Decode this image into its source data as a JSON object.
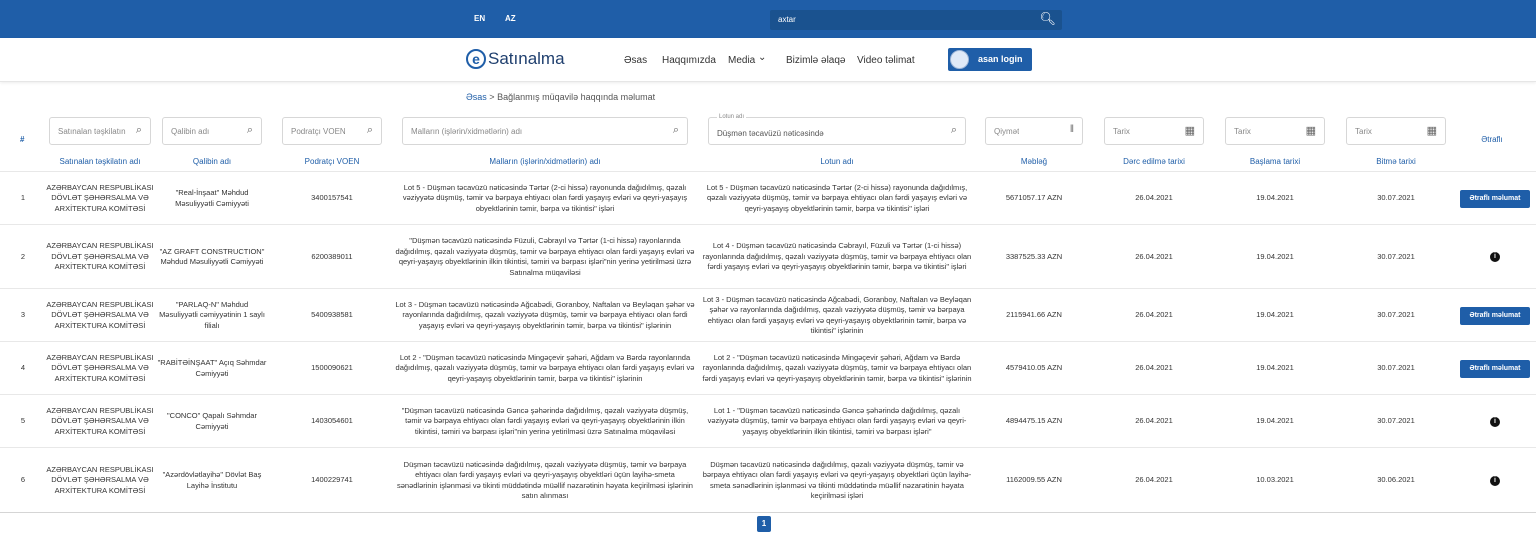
{
  "topbar": {
    "lang_en": "EN",
    "lang_az": "AZ",
    "search_value": "axtar"
  },
  "nav": {
    "logo_e": "e",
    "logo_text": "Satınalma",
    "items": [
      "Əsas",
      "Haqqımızda",
      "Media",
      "Bizimlə əlaqə",
      "Video təlimat"
    ],
    "media_caret": "⌄",
    "login": "asan login"
  },
  "breadcrumb": {
    "home": "Əsas",
    "sep": ">",
    "current": "Bağlanmış müqavilə haqqında məlumat"
  },
  "filters": {
    "org": "Satınalan təşkilatın ...",
    "winner": "Qalibin adı",
    "voen": "Podratçı VOEN",
    "goods": "Malların (işlərin/xidmətlərin) adı",
    "lot_label": "Lotun adı",
    "lot": "Düşmən təcavüzü nəticəsində",
    "price": "Qiymət",
    "date1": "Tarix",
    "date2": "Tarix",
    "date3": "Tarix"
  },
  "headers": {
    "hash": "#",
    "org": "Satınalan təşkilatın adı",
    "winner": "Qalibin adı",
    "voen": "Podratçı VOEN",
    "goods": "Malların (işlərin/xidmətlərin) adı",
    "lot": "Lotun adı",
    "amount": "Məbləğ",
    "pub": "Dərc edilmə tarixi",
    "start": "Başlama tarixi",
    "end": "Bitmə tarixi",
    "more": "Ətraflı"
  },
  "rows": [
    {
      "n": "1",
      "org": "AZƏRBAYCAN RESPUBLİKASI DÖVLƏT ŞƏHƏRSALMA VƏ ARXİTEKTURA KOMİTƏSİ",
      "winner": "\"Real-İnşaat\" Məhdud Məsuliyyətli Cəmiyyəti",
      "voen": "3400157541",
      "goods": "Lot 5 - Düşmən təcavüzü nəticəsində Tərtər (2-ci hissə) rayonunda dağıdılmış, qəzalı vəziyyətə düşmüş, təmir və bərpaya ehtiyacı olan fərdi yaşayış evləri və qeyri-yaşayış obyektlərinin təmir, bərpa və tikintisi\" işləri",
      "lot": "Lot 5 - Düşmən təcavüzü nəticəsində Tərtər (2-ci hissə) rayonunda dağıdılmış, qəzalı vəziyyətə düşmüş, təmir və bərpaya ehtiyacı olan fərdi yaşayış evləri və qeyri-yaşayış obyektlərinin təmir, bərpa və tikintisi\" işləri",
      "amount": "5671057.17 AZN",
      "pub": "26.04.2021",
      "start": "19.04.2021",
      "end": "30.07.2021",
      "action": "button"
    },
    {
      "n": "2",
      "org": "AZƏRBAYCAN RESPUBLİKASI DÖVLƏT ŞƏHƏRSALMA VƏ ARXİTEKTURA KOMİTƏSİ",
      "winner": "\"AZ GRAFT CONSTRUCTION\" Məhdud Məsuliyyətli Cəmiyyəti",
      "voen": "6200389011",
      "goods": "\"Düşmən təcavüzü nəticəsində Füzuli, Cəbrayıl və Tərtər (1-ci hissə) rayonlarında dağıdılmış, qəzalı vəziyyətə düşmüş, təmir və bərpaya ehtiyacı olan fərdi yaşayış evləri və qeyri-yaşayış obyektlərinin ilkin tikintisi, təmiri və bərpası işləri\"nin yerinə yetirilməsi üzrə Satınalma müqaviləsi",
      "lot": "Lot 4 - Düşmən təcavüzü nəticəsində Cəbrayıl, Füzuli və Tərtər (1-ci hissə) rayonlarında dağıdılmış, qəzalı vəziyyətə düşmüş, təmir və bərpaya ehtiyacı olan fərdi yaşayış evləri və qeyri-yaşayış obyektlərinin təmir, bərpa və tikintisi\" işləri",
      "amount": "3387525.33 AZN",
      "pub": "26.04.2021",
      "start": "19.04.2021",
      "end": "30.07.2021",
      "action": "info"
    },
    {
      "n": "3",
      "org": "AZƏRBAYCAN RESPUBLİKASI DÖVLƏT ŞƏHƏRSALMA VƏ ARXİTEKTURA KOMİTƏSİ",
      "winner": "\"PARLAQ-N\" Məhdud Məsuliyyətli cəmiyyətinin 1 saylı filialı",
      "voen": "5400938581",
      "goods": "Lot 3 - Düşmən təcavüzü nəticəsində Ağcabədi, Goranboy, Naftalan və Beyləqan şəhər və rayonlarında dağıdılmış, qəzalı vəziyyətə düşmüş, təmir və bərpaya ehtiyacı olan fərdi yaşayış evləri və qeyri-yaşayış obyektlərinin təmir, bərpa və tikintisi\" işlərinin",
      "lot": "Lot 3 - Düşmən təcavüzü nəticəsində Ağcabədi, Goranboy, Naftalan və Beyləqan şəhər və rayonlarında dağıdılmış, qəzalı vəziyyətə düşmüş, təmir və bərpaya ehtiyacı olan fərdi yaşayış evləri və qeyri-yaşayış obyektlərinin təmir, bərpa və tikintisi\" işlərinin",
      "amount": "2115941.66 AZN",
      "pub": "26.04.2021",
      "start": "19.04.2021",
      "end": "30.07.2021",
      "action": "button"
    },
    {
      "n": "4",
      "org": "AZƏRBAYCAN RESPUBLİKASI DÖVLƏT ŞƏHƏRSALMA VƏ ARXİTEKTURA KOMİTƏSİ",
      "winner": "\"RABİTƏİNŞAAT\" Açıq Səhmdar Cəmiyyəti",
      "voen": "1500090621",
      "goods": "Lot 2 - \"Düşmən təcavüzü nəticəsində Mingəçevir şəhəri, Ağdam və Bərdə rayonlarında dağıdılmış, qəzalı vəziyyətə düşmüş, təmir və bərpaya ehtiyacı olan fərdi yaşayış evləri və qeyri-yaşayış obyektlərinin təmir, bərpa və tikintisi\" işlərinin",
      "lot": "Lot 2 - \"Düşmən təcavüzü nəticəsində Mingəçevir şəhəri, Ağdam və Bərdə rayonlarında dağıdılmış, qəzalı vəziyyətə düşmüş, təmir və bərpaya ehtiyacı olan fərdi yaşayış evləri və qeyri-yaşayış obyektlərinin təmir, bərpa və tikintisi\" işlərinin",
      "amount": "4579410.05 AZN",
      "pub": "26.04.2021",
      "start": "19.04.2021",
      "end": "30.07.2021",
      "action": "button"
    },
    {
      "n": "5",
      "org": "AZƏRBAYCAN RESPUBLİKASI DÖVLƏT ŞƏHƏRSALMA VƏ ARXİTEKTURA KOMİTƏSİ",
      "winner": "\"CONCO\" Qapalı Səhmdar Cəmiyyəti",
      "voen": "1403054601",
      "goods": "\"Düşmən təcavüzü nəticəsində Gəncə şəhərində dağıdılmış, qəzalı vəziyyətə düşmüş, təmir və bərpaya ehtiyacı olan fərdi yaşayış evləri və qeyri-yaşayış obyektlərinin ilkin tikintisi, təmiri və bərpası işləri\"nin yerinə yetirilməsi üzrə Satınalma müqaviləsi",
      "lot": "Lot 1 - \"Düşmən təcavüzü nəticəsində Gəncə şəhərində dağıdılmış, qəzalı vəziyyətə düşmüş, təmir və bərpaya ehtiyacı olan fərdi yaşayış evləri və qeyri-yaşayış obyektlərinin ilkin tikintisi, təmiri və bərpası işləri\"",
      "amount": "4894475.15 AZN",
      "pub": "26.04.2021",
      "start": "19.04.2021",
      "end": "30.07.2021",
      "action": "info"
    },
    {
      "n": "6",
      "org": "AZƏRBAYCAN RESPUBLİKASI DÖVLƏT ŞƏHƏRSALMA VƏ ARXİTEKTURA KOMİTƏSİ",
      "winner": "\"Azərdövlətlayihə\" Dövlət Baş Layihə İnstitutu",
      "voen": "1400229741",
      "goods": "Düşmən təcavüzü nəticəsində dağıdılmış, qəzalı vəziyyətə düşmüş, təmir və bərpaya ehtiyacı olan fərdi yaşayış evləri və qeyri-yaşayış obyektləri üçün layihə-smeta sənədlərinin işlənməsi və tikinti müddətində müəllif nəzarətinin həyata keçirilməsi işlərinin satın alınması",
      "lot": "Düşmən təcavüzü nəticəsində dağıdılmış, qəzalı vəziyyətə düşmüş, təmir və bərpaya ehtiyacı olan fərdi yaşayış evləri və qeyri-yaşayış obyektləri üçün layihə-smeta sənədlərinin işlənməsi və tikinti müddətində müəllif nəzarətinin həyata keçirilməsi işləri",
      "amount": "1162009.55 AZN",
      "pub": "26.04.2021",
      "start": "10.03.2021",
      "end": "30.06.2021",
      "action": "info"
    }
  ],
  "button_label": "Ətraflı məlumat",
  "info_glyph": "i",
  "pagination": {
    "current": "1"
  },
  "icons": {
    "search": "search-icon",
    "calendar": "calendar-icon",
    "info": "info-icon"
  }
}
